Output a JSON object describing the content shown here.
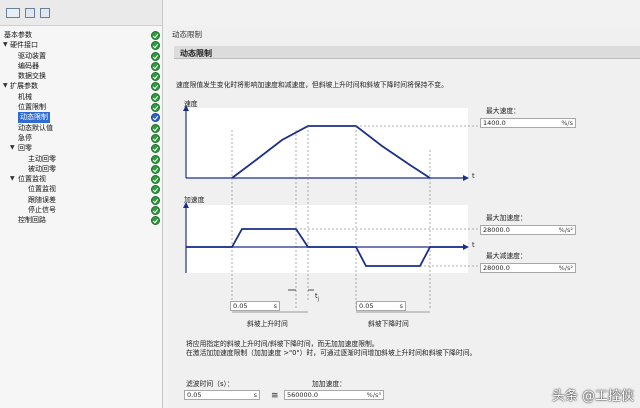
{
  "tree": {
    "items": [
      {
        "label": "基本参数",
        "indent": 0,
        "arrow": "",
        "status": "green"
      },
      {
        "label": "硬件接口",
        "indent": 1,
        "arrow": "▼",
        "status": "green"
      },
      {
        "label": "驱动装置",
        "indent": 2,
        "arrow": "",
        "status": "green"
      },
      {
        "label": "编码器",
        "indent": 2,
        "arrow": "",
        "status": "green"
      },
      {
        "label": "数据交换",
        "indent": 2,
        "arrow": "",
        "status": "green"
      },
      {
        "label": "扩展参数",
        "indent": 1,
        "arrow": "▼",
        "status": "green"
      },
      {
        "label": "机械",
        "indent": 2,
        "arrow": "",
        "status": "green"
      },
      {
        "label": "位置限制",
        "indent": 2,
        "arrow": "",
        "status": "green"
      },
      {
        "label": "动态限制",
        "indent": 2,
        "arrow": "",
        "status": "blue",
        "selected": true
      },
      {
        "label": "动态默认值",
        "indent": 2,
        "arrow": "",
        "status": "green"
      },
      {
        "label": "急停",
        "indent": 2,
        "arrow": "",
        "status": "green"
      },
      {
        "label": "回零",
        "indent": 2,
        "arrow": "▼",
        "status": "green"
      },
      {
        "label": "主动回零",
        "indent": 3,
        "arrow": "",
        "status": "green"
      },
      {
        "label": "被动回零",
        "indent": 3,
        "arrow": "",
        "status": "green"
      },
      {
        "label": "位置监视",
        "indent": 2,
        "arrow": "▼",
        "status": "green"
      },
      {
        "label": "位置监视",
        "indent": 3,
        "arrow": "",
        "status": "green"
      },
      {
        "label": "跟随误差",
        "indent": 3,
        "arrow": "",
        "status": "green"
      },
      {
        "label": "停止信号",
        "indent": 3,
        "arrow": "",
        "status": "green"
      },
      {
        "label": "控制回路",
        "indent": 2,
        "arrow": "",
        "status": "green"
      }
    ]
  },
  "breadcrumb": "动态限制",
  "section_title": "动态限制",
  "description": "速度限值发生变化时将影响加速度和减速度，但斜坡上升时间和斜坡下降时间将保持不变。",
  "velocity_chart": {
    "ylabel": "速度",
    "xlabel": "t"
  },
  "accel_chart": {
    "ylabel": "加速度",
    "xlabel": "t",
    "jerk_label": "t",
    "jerk_sub": "j"
  },
  "max_velocity": {
    "label": "最大速度：",
    "value": "1400.0",
    "unit": "%/s"
  },
  "max_accel": {
    "label": "最大加速度：",
    "value": "28000.0",
    "unit": "%/s²"
  },
  "max_decel": {
    "label": "最大减速度：",
    "value": "28000.0",
    "unit": "%/s²"
  },
  "ramp_up": {
    "value": "0.05",
    "unit": "s",
    "label": "斜坡上升时间"
  },
  "ramp_down": {
    "value": "0.05",
    "unit": "s",
    "label": "斜坡下降时间"
  },
  "note_line1": "将应用指定的斜坡上升时间/斜坡下降时间，而无加加速度限制。",
  "note_line2": "在激活加加速度限制（加加速度 >\"0\"）时，可通过逐渐时间增加斜坡上升时间和斜坡下降时间。",
  "smoothing_time": {
    "label": "滤波时间（s）：",
    "value": "0.05",
    "unit": "s"
  },
  "jerk": {
    "label": "加加速度：",
    "value": "560000.0",
    "unit": "%/s³",
    "eq": "≅"
  },
  "watermark": "头条 @工控侠",
  "colors": {
    "curve": "#1b2f8a",
    "check_green": "#2e9b3c",
    "selection": "#2f6bd1"
  }
}
